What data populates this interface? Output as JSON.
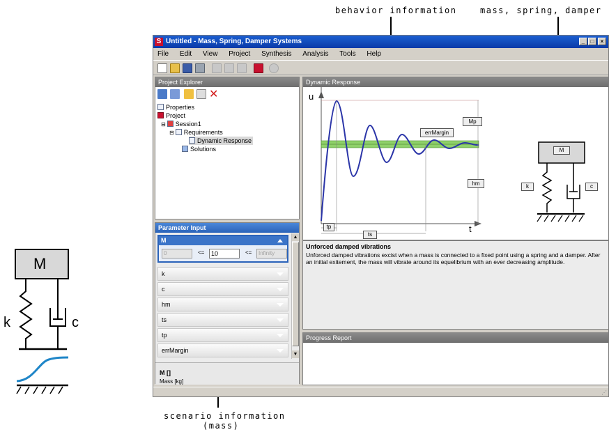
{
  "callouts": {
    "behavior": "behavior information",
    "msd": "mass, spring, damper",
    "scenario_line1": "scenario information",
    "scenario_line2": "(mass)"
  },
  "left_diagram": {
    "mass_label": "M",
    "spring_label": "k",
    "damper_label": "c"
  },
  "window": {
    "title": "Untitled - Mass, Spring, Damper Systems",
    "menus": [
      "File",
      "Edit",
      "View",
      "Project",
      "Synthesis",
      "Analysis",
      "Tools",
      "Help"
    ]
  },
  "explorer": {
    "title": "Project Explorer",
    "items": [
      "Properties",
      "Project",
      "Session1",
      "Requirements",
      "Dynamic Response",
      "Solutions"
    ]
  },
  "param_input": {
    "title": "Parameter Input",
    "selected": "M",
    "min_placeholder": "0",
    "op1": "<=",
    "value": "10",
    "op2": "<=",
    "max_placeholder": "Infinity",
    "rows": [
      "k",
      "c",
      "hm",
      "ts",
      "tp",
      "errMargin"
    ],
    "footer_title": "M []",
    "footer_sub": "Mass [kg]"
  },
  "dynamic_response": {
    "title": "Dynamic Response",
    "y_label": "u",
    "x_label": "t",
    "labels": {
      "mp": "Mp",
      "err": "errMargin",
      "hm": "hm",
      "tp": "tp",
      "ts": "ts"
    },
    "diagram": {
      "mass_label": "M",
      "spring_label": "k",
      "damper_label": "c"
    }
  },
  "description": {
    "title": "Unforced damped vibrations",
    "body": "Unforced damped vibrations excist when a mass is connected to a fixed point using a spring and a damper. After an initial exitement, the mass will vibrate around its equelibrium with an ever decreasing amplitude."
  },
  "progress": {
    "title": "Progress Report"
  },
  "colors": {
    "title_blue": "#0a3aa8",
    "curve": "#2b35a8",
    "band": "#8fd16a",
    "accent": "#c8102e"
  }
}
